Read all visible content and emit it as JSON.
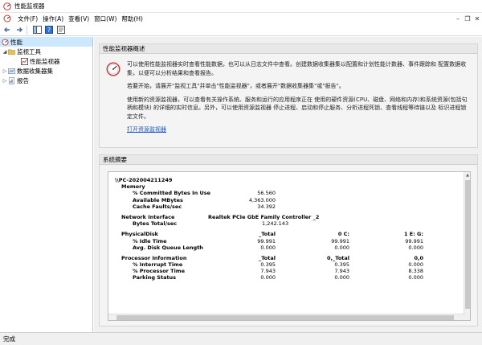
{
  "window": {
    "title": "性能监视器"
  },
  "menu": [
    {
      "label": "文件(F)"
    },
    {
      "label": "操作(A)"
    },
    {
      "label": "查看(V)"
    },
    {
      "label": "窗口(W)"
    },
    {
      "label": "帮助(H)"
    }
  ],
  "tree": {
    "root": "性能",
    "monitoring_tools": "监视工具",
    "perf_monitor": "性能监视器",
    "data_collector_sets": "数据收集器集",
    "reports": "报告"
  },
  "overview": {
    "header": "性能监视器概述",
    "p1": "可以使用性能监视器实时查看性能数据，也可以从日志文件中查看。创建数据收集器集以配置和计划性能计数器、事件跟踪和 配置数据收集，以便可以分析结果和查看报告。",
    "p2": "若要开始，请展开\"监视工具\"并单击\"性能监视器\"，或者展开\"数据收集器集\"或\"报告\"。",
    "p3": "使用新的资源监视器，可以查看有关操作系统、服务和运行的应用程序正在 使用的硬件资源(CPU、磁盘、网络和内存)和系统资源(包括句柄和模块) 的详细的实时信息。另外，可以使用资源监视器 停止进程、启动和停止服务、分析进程死锁、查看线程等待链以及 标识进程锁定文件。",
    "link": "打开资源监视器"
  },
  "summary": {
    "header": "系统摘要",
    "machine": "\\\\PC-202004211249",
    "memory": {
      "label": "Memory",
      "committed_label": "% Committed Bytes In Use",
      "committed": "56.560",
      "available_label": "Available MBytes",
      "available": "4,363.000",
      "cache_label": "Cache Faults/sec",
      "cache": "34.392"
    },
    "network": {
      "label": "Network Interface",
      "adapter": "Realtek PCIe GbE Family Controller _2",
      "bytes_label": "Bytes Total/sec",
      "bytes": "1,242.143"
    },
    "disk": {
      "label": "PhysicalDisk",
      "col1": "_Total",
      "col2": "0 C:",
      "col3": "1 E: G:",
      "idle_label": "% Idle Time",
      "idle": [
        "99.991",
        "99.991",
        "99.991"
      ],
      "queue_label": "Avg. Disk Queue Length",
      "queue": [
        "0.000",
        "0.000",
        "0.000"
      ]
    },
    "processor": {
      "label": "Processor Information",
      "col1": "_Total",
      "col2": "0,_Total",
      "col3": "0,0",
      "interrupt_label": "% Interrupt Time",
      "interrupt": [
        "0.395",
        "0.395",
        "0.000"
      ],
      "proc_label": "% Processor Time",
      "proc": [
        "7.943",
        "7.943",
        "8.338"
      ],
      "parking_label": "Parking Status",
      "parking": [
        "0.000",
        "0.000",
        "0.000"
      ]
    }
  },
  "status": {
    "text": "完成"
  }
}
